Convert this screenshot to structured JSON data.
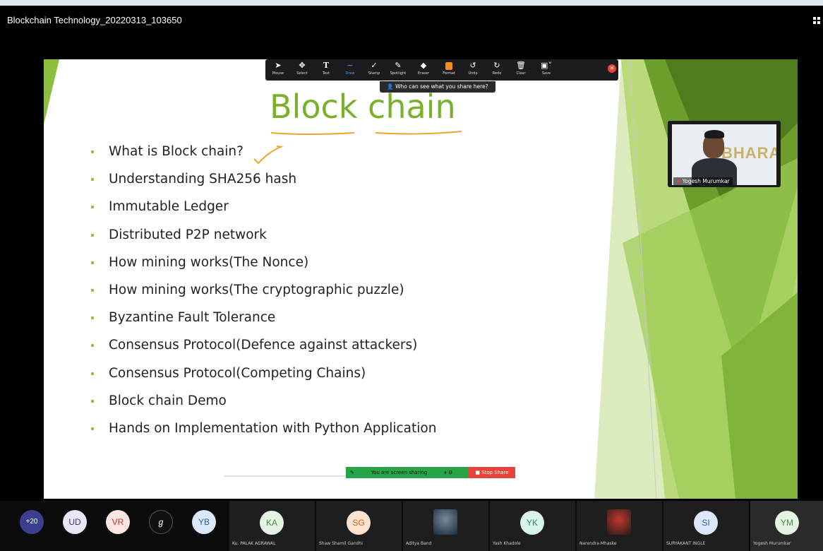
{
  "window": {
    "title": "Blockchain Technology_20220313_103650"
  },
  "slide": {
    "title": "Block chain",
    "bullets": [
      "What is Block chain?",
      "Understanding SHA256 hash",
      "Immutable Ledger",
      "Distributed P2P network",
      "How mining works(The Nonce)",
      "How mining works(The cryptographic puzzle)",
      "Byzantine Fault Tolerance",
      "Consensus Protocol(Defence against attackers)",
      "Consensus Protocol(Competing Chains)",
      "Block chain Demo",
      "Hands on Implementation with Python Application"
    ],
    "colors": {
      "title": "#7ab02c",
      "bullet": "#8cbf3f",
      "green_dark": "#6b9e2a",
      "green_light": "#b9d97a"
    }
  },
  "toolbar": {
    "tools": [
      {
        "label": "Mouse",
        "icon": "pointer-icon"
      },
      {
        "label": "Select",
        "icon": "move-icon"
      },
      {
        "label": "Text",
        "icon": "text-icon"
      },
      {
        "label": "Draw",
        "icon": "draw-icon"
      },
      {
        "label": "Stamp",
        "icon": "checkmark-icon"
      },
      {
        "label": "Spotlight",
        "icon": "spotlight-icon"
      },
      {
        "label": "Eraser",
        "icon": "eraser-icon"
      },
      {
        "label": "Format",
        "icon": "format-icon"
      },
      {
        "label": "Undo",
        "icon": "undo-icon"
      },
      {
        "label": "Redo",
        "icon": "redo-icon"
      },
      {
        "label": "Clear",
        "icon": "trash-icon"
      },
      {
        "label": "Save",
        "icon": "save-icon"
      }
    ],
    "who_can_see": "Who can see what you share here?",
    "accent": "#5b9cf0"
  },
  "presenter": {
    "name": "Yogesh Murumkar",
    "backdrop_text": "BHARAT"
  },
  "share_bar": {
    "status": "You are screen sharing",
    "stop_label": "Stop Share"
  },
  "gallery": {
    "overflow": "+20",
    "bubbles": [
      {
        "initials": "UD",
        "bg": "#e9e6f7",
        "fg": "#3b3a8f"
      },
      {
        "initials": "VR",
        "bg": "#fbe4e2",
        "fg": "#c0392b"
      },
      {
        "initials": "",
        "bg": "#111111",
        "fg": "#ffffff",
        "icon": "signature-avatar-icon"
      },
      {
        "initials": "YB",
        "bg": "#dbe8fb",
        "fg": "#2d5ea8"
      }
    ],
    "tiles": [
      {
        "initials": "KA",
        "name": "Ku. PALAK AGRAWAL",
        "bg": "#e4f3e4",
        "fg": "#4a8a4a"
      },
      {
        "initials": "SG",
        "name": "Shaw Shamil Gandhi",
        "bg": "#fbe3cf",
        "fg": "#c2661a"
      },
      {
        "initials": "",
        "name": "Aditya Band",
        "photo": "avatar-photo-icon"
      },
      {
        "initials": "YK",
        "name": "Yash Khadole",
        "bg": "#d9f2ec",
        "fg": "#2a8a74"
      },
      {
        "initials": "",
        "name": "Narendra Mhaske",
        "photo": "avatar-photo-icon"
      },
      {
        "initials": "SI",
        "name": "SURYAKANT INGLE",
        "bg": "#dbe8fb",
        "fg": "#2d5ea8"
      },
      {
        "initials": "YM",
        "name": "Yogesh Murumkar",
        "bg": "#e4f3e4",
        "fg": "#4a8a4a"
      }
    ]
  }
}
